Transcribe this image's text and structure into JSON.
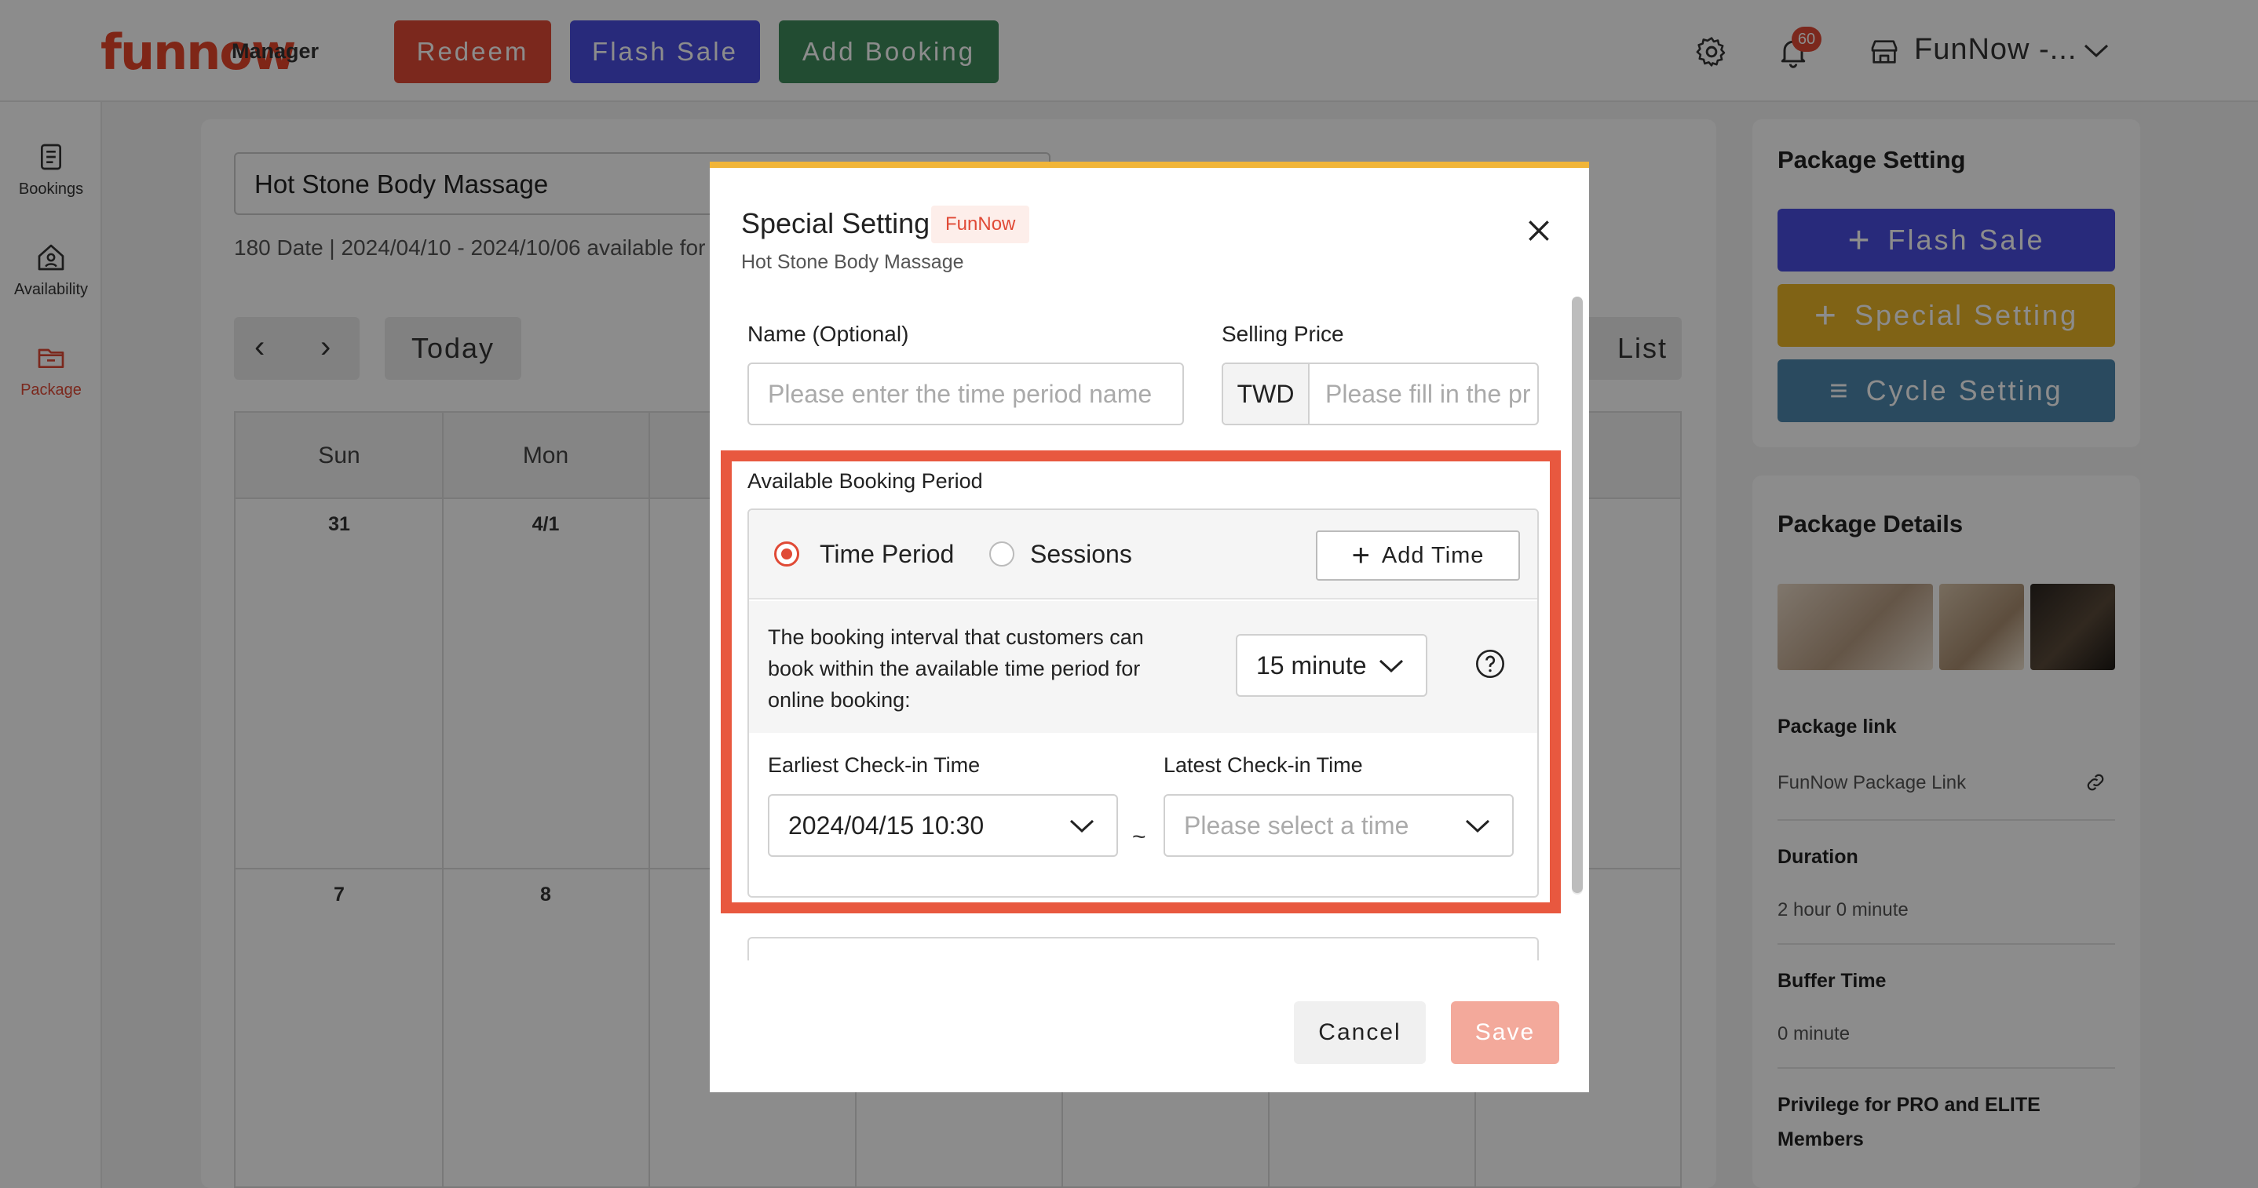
{
  "header": {
    "logo": "funnow",
    "logo_sub": "Manager",
    "redeem_label": "Redeem",
    "flash_sale_label": "Flash Sale",
    "add_booking_label": "Add Booking",
    "notification_count": "60",
    "store_name": "FunNow -..."
  },
  "sidebar": {
    "items": [
      {
        "label": "Bookings",
        "icon": "document-icon"
      },
      {
        "label": "Availability",
        "icon": "home-user-icon"
      },
      {
        "label": "Package",
        "icon": "folder-icon"
      }
    ]
  },
  "main": {
    "package_name": "Hot Stone Body Massage",
    "date_info": "180 Date | 2024/04/10 - 2024/10/06 available for",
    "today_label": "Today",
    "list_label": "List",
    "weekdays": [
      "Sun",
      "Mon"
    ],
    "days_row1": [
      "31",
      "4/1"
    ],
    "days_row2": [
      "7",
      "8"
    ]
  },
  "right_panel": {
    "package_setting_title": "Package Setting",
    "flash_sale_label": "Flash Sale",
    "special_setting_label": "Special Setting",
    "cycle_setting_label": "Cycle Setting",
    "package_details_title": "Package Details",
    "package_link_label": "Package link",
    "package_link_value": "FunNow Package Link",
    "duration_label": "Duration",
    "duration_value": "2 hour 0 minute",
    "buffer_label": "Buffer Time",
    "buffer_value": "0 minute",
    "privilege_label_line1": "Privilege for PRO and ELITE",
    "privilege_label_line2": "Members"
  },
  "modal": {
    "title": "Special Setting",
    "tag": "FunNow",
    "subtitle": "Hot Stone Body Massage",
    "name_label": "Name (Optional)",
    "name_placeholder": "Please enter the time period name",
    "price_label": "Selling Price",
    "price_currency": "TWD",
    "price_placeholder": "Please fill in the price",
    "period_title": "Available Booking Period",
    "mode_time_period": "Time Period",
    "mode_sessions": "Sessions",
    "selected_mode": "Time Period",
    "add_time_label": "Add Time",
    "interval_text": "The booking interval that customers can book within the available time period for online booking:",
    "interval_value": "15 minute",
    "earliest_label": "Earliest Check-in Time",
    "earliest_value": "2024/04/15 10:30",
    "latest_label": "Latest Check-in Time",
    "latest_placeholder": "Please select a time",
    "range_separator": "~",
    "cancel_label": "Cancel",
    "save_label": "Save"
  },
  "colors": {
    "brand": "#e04a36",
    "flash_sale": "#4a4ee0",
    "add_booking": "#3f8a5c",
    "special_setting": "#eab527",
    "cycle_setting": "#4d88ad",
    "modal_top_border": "#f1b538",
    "highlight_border": "#e8583f"
  }
}
